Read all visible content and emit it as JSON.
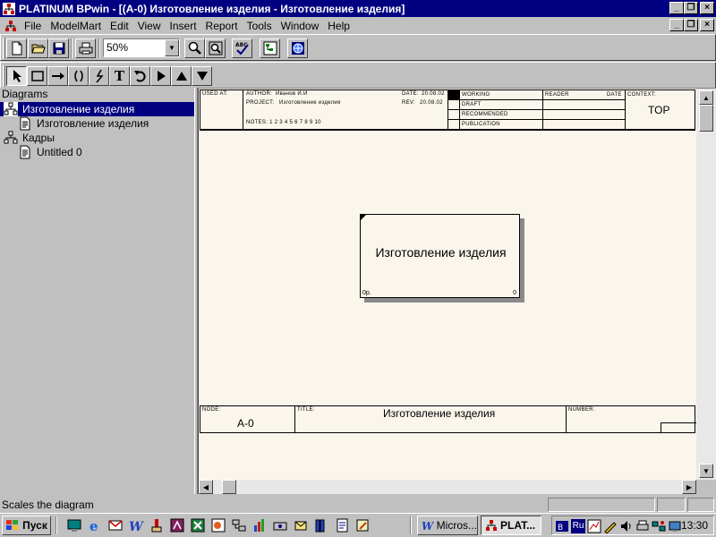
{
  "window": {
    "title": "PLATINUM BPwin - [(A-0) Изготовление изделия - Изготовление изделия]"
  },
  "menu": {
    "items": [
      "File",
      "ModelMart",
      "Edit",
      "View",
      "Insert",
      "Report",
      "Tools",
      "Window",
      "Help"
    ]
  },
  "toolbar": {
    "zoom_value": "50%"
  },
  "drawing_tools": {
    "text_tool_label": "T"
  },
  "diagrams_panel": {
    "header": "Diagrams",
    "items": [
      {
        "label": "Изготовление изделия",
        "selected": true,
        "icon": "model-icon"
      },
      {
        "label": "Изготовление изделия",
        "selected": false,
        "icon": "diagram-page-icon"
      },
      {
        "label": "Кадры",
        "selected": false,
        "icon": "model-icon"
      },
      {
        "label": "Untitled 0",
        "selected": false,
        "icon": "diagram-page-icon"
      }
    ]
  },
  "idef0_form": {
    "used_at": "USED AT:",
    "author_label": "AUTHOR:",
    "author": "Иванов И.И",
    "project_label": "PROJECT:",
    "project": "Изготовление изделия",
    "date_label": "DATE:",
    "date": "20.08.02",
    "rev_label": "REV:",
    "rev": "20.08.02",
    "notes": "NOTES: 1 2 3 4 5 6 7 8 9 10",
    "status": [
      "WORKING",
      "DRAFT",
      "RECOMMENDED",
      "PUBLICATION"
    ],
    "reader_label": "READER",
    "reader_date_label": "DATE",
    "context_label": "CONTEXT:",
    "context_value": "TOP",
    "node_label": "NODE:",
    "node_value": "A-0",
    "title_label": "TITLE:",
    "title_value": "Изготовление изделия",
    "number_label": "NUMBER:"
  },
  "activity_box": {
    "name": "Изготовление изделия",
    "cost": "0р.",
    "number": "0"
  },
  "statusbar": {
    "text": "Scales the diagram"
  },
  "taskbar": {
    "start_label": "Пуск",
    "tasks": [
      {
        "label": "Micros...",
        "active": false
      },
      {
        "label": "PLAT...",
        "active": true
      }
    ],
    "language": "Ru",
    "clock": "13:30"
  }
}
